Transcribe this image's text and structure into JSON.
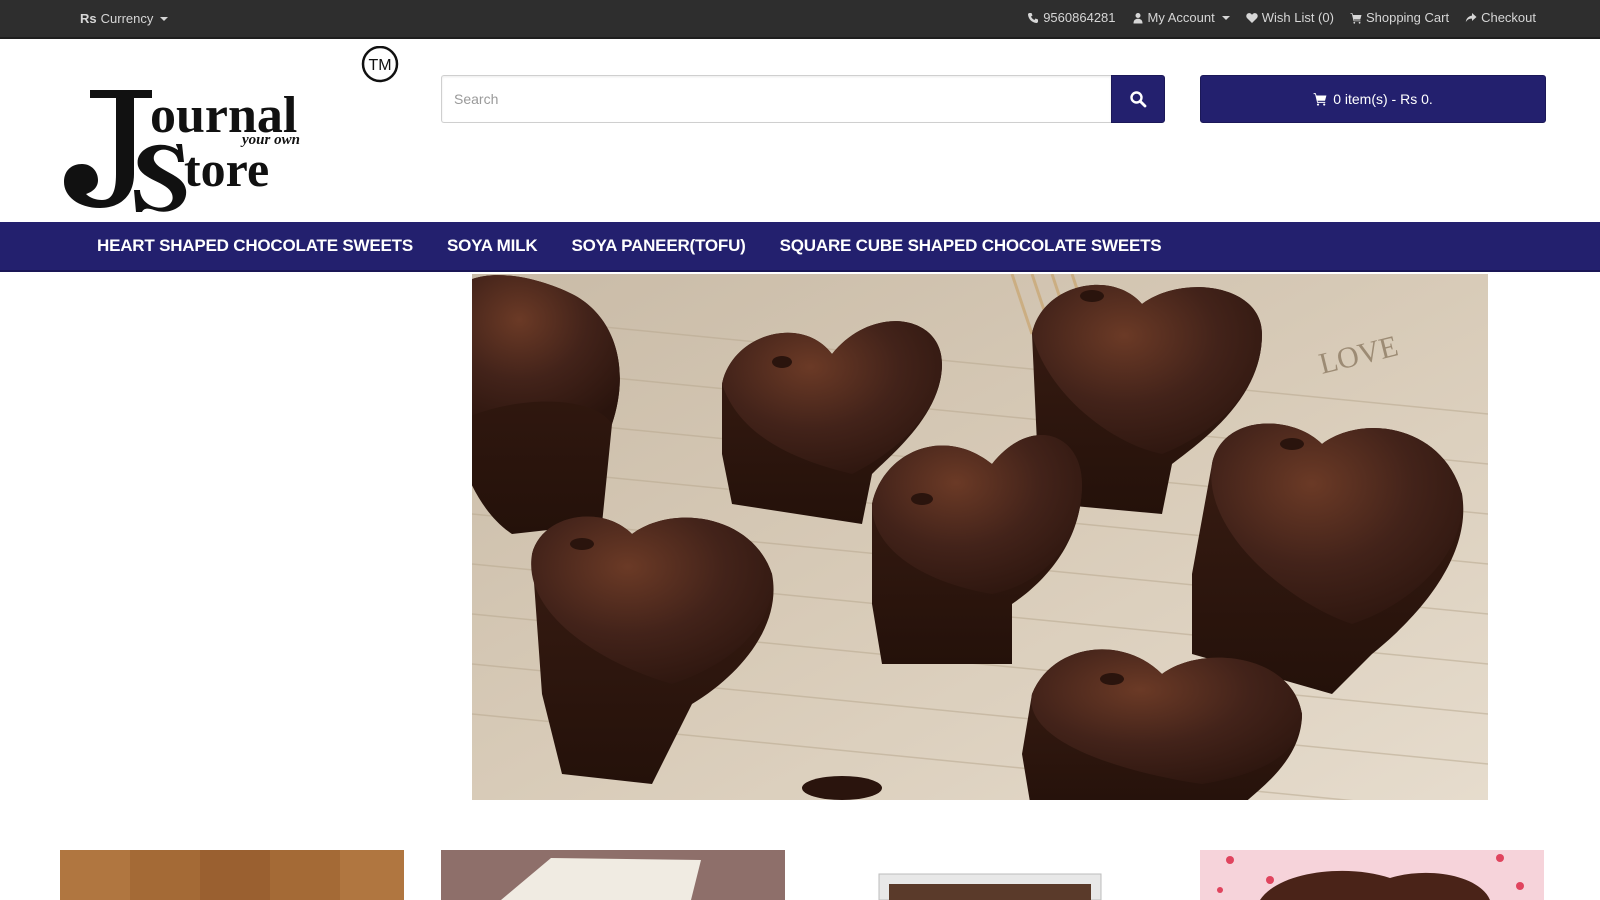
{
  "topbar": {
    "currency_symbol": "Rs",
    "currency_label": "Currency",
    "phone": "9560864281",
    "my_account": "My Account",
    "wish_list": "Wish List (0)",
    "shopping_cart": "Shopping Cart",
    "checkout": "Checkout"
  },
  "logo": {
    "line1": "ournal",
    "line2": "tore",
    "tagline": "your own",
    "tm": "TM"
  },
  "search": {
    "placeholder": "Search",
    "button_icon": "search-icon"
  },
  "cart": {
    "label": "0 item(s) - Rs 0."
  },
  "nav": {
    "items": [
      "HEART SHAPED CHOCOLATE SWEETS",
      "SOYA MILK",
      "SOYA PANEER(TOFU)",
      "SQUARE CUBE SHAPED CHOCOLATE SWEETS"
    ]
  },
  "slider": {
    "image_text": "LOVE"
  },
  "colors": {
    "topbar_bg": "#2e2e2e",
    "brand": "#23206e",
    "chocolate": "#3e2015"
  }
}
